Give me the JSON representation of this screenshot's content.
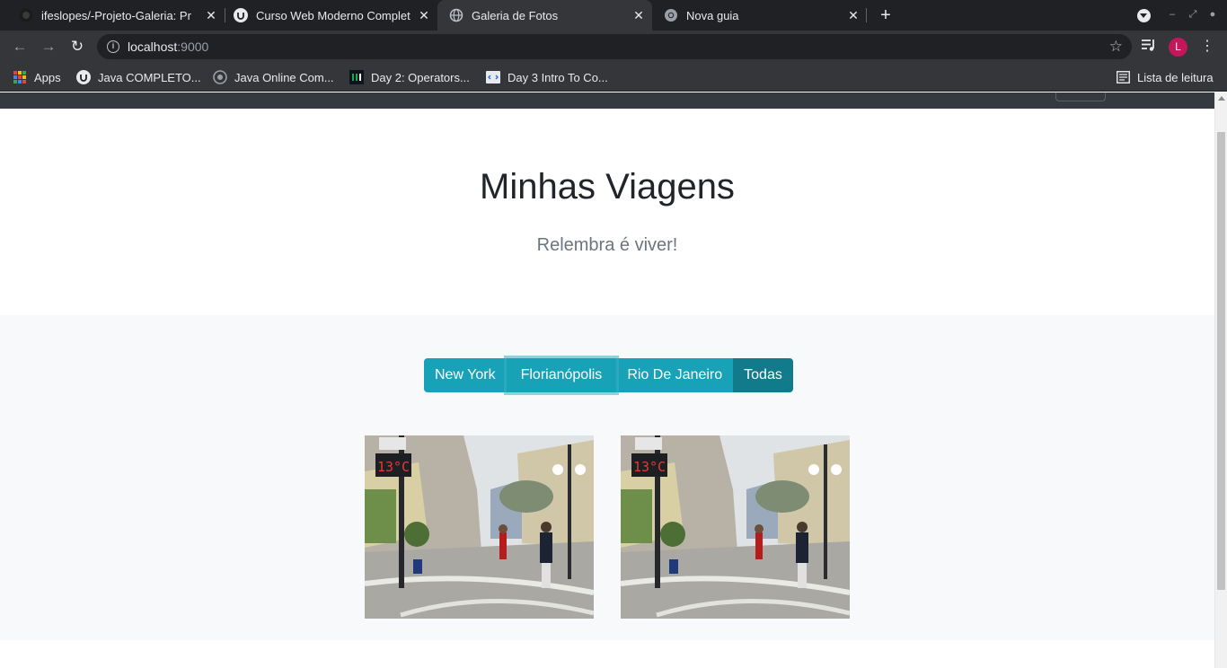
{
  "browser": {
    "tabs": [
      {
        "title": "ifeslopes/-Projeto-Galeria: Pr",
        "favicon": "github-icon",
        "active": false
      },
      {
        "title": "Curso Web Moderno Complet",
        "favicon": "udemy-icon",
        "active": false
      },
      {
        "title": "Galeria de Fotos",
        "favicon": "globe-icon",
        "active": true
      },
      {
        "title": "Nova guia",
        "favicon": "chrome-icon",
        "active": false
      }
    ],
    "close_glyph": "✕",
    "new_tab_glyph": "+",
    "url_host": "localhost",
    "url_port": ":9000",
    "profile_initial": "L",
    "profile_color": "#c2185b",
    "bookmarks": [
      {
        "label": "Apps",
        "icon": "apps-grid-icon"
      },
      {
        "label": "Java COMPLETO...",
        "icon": "udemy-icon"
      },
      {
        "label": "Java Online Com...",
        "icon": "compiler-icon"
      },
      {
        "label": "Day 2: Operators...",
        "icon": "hackerrank-icon"
      },
      {
        "label": "Day 3 Intro To Co...",
        "icon": "code-icon"
      }
    ],
    "reading_list_label": "Lista de leitura"
  },
  "page": {
    "title": "Minhas Viagens",
    "subtitle": "Relembra é viver!",
    "filters": [
      {
        "label": "New York",
        "state": "default"
      },
      {
        "label": "Florianópolis",
        "state": "focused"
      },
      {
        "label": "Rio De Janeiro",
        "state": "default"
      },
      {
        "label": "Todas",
        "state": "active"
      }
    ],
    "photos": [
      {
        "subject": "florianopolis-street-photo",
        "clock_text": "13°C"
      },
      {
        "subject": "florianopolis-street-photo",
        "clock_text": "13°C"
      }
    ]
  },
  "colors": {
    "button_info": "#17a2b8",
    "button_active": "#117a8b",
    "navbar_dark": "#343a40",
    "section_light": "#f8f9fa"
  }
}
